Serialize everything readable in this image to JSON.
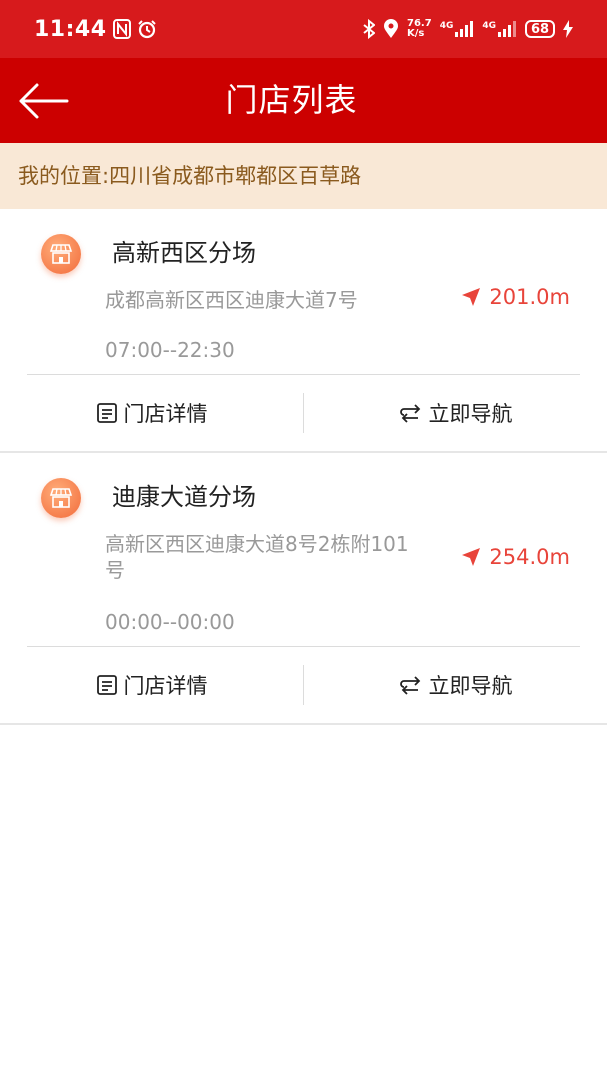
{
  "status_bar": {
    "time": "11:44",
    "net_speed_top": "76.7",
    "net_speed_bottom": "K/s",
    "net1": "4G",
    "net2": "4G",
    "battery": "68"
  },
  "nav": {
    "title": "门店列表"
  },
  "location": {
    "text": "我的位置:四川省成都市郫都区百草路"
  },
  "stores": [
    {
      "name": "高新西区分场",
      "address": "成都高新区西区迪康大道7号",
      "distance": "201.0m",
      "hours": "07:00--22:30",
      "detail_label": "门店详情",
      "navigate_label": "立即导航"
    },
    {
      "name": "迪康大道分场",
      "address": "高新区西区迪康大道8号2栋附101号",
      "distance": "254.0m",
      "hours": "00:00--00:00",
      "detail_label": "门店详情",
      "navigate_label": "立即导航"
    }
  ],
  "colors": {
    "status_bar": "#d71a1c",
    "nav_bar": "#cc0000",
    "location_bg": "#f9e8d6",
    "distance": "#e8443a"
  }
}
